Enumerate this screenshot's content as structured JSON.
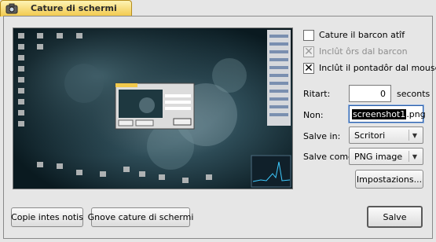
{
  "tab": {
    "title": "Cature di schermi"
  },
  "options": {
    "capture_window": {
      "label": "Cature il barcon atîf",
      "checked": false,
      "enabled": true
    },
    "include_borders": {
      "label": "Inclût ôrs dal barcon",
      "checked": true,
      "enabled": false
    },
    "include_pointer": {
      "label": "Inclût il pontadôr dal mouse",
      "checked": true,
      "enabled": true
    }
  },
  "delay": {
    "label": "Ritart:",
    "value": "0",
    "unit": "seconts"
  },
  "name": {
    "label": "Non:",
    "value": "screenshot1.png",
    "selected_part": "screenshot1",
    "rest": ".png"
  },
  "save_in": {
    "label": "Salve in:",
    "value": "Scritori"
  },
  "save_as": {
    "label": "Salve come:",
    "value": "PNG image"
  },
  "buttons": {
    "settings": "Impostazions...",
    "copy": "Copie intes notis",
    "new_capture": "Gnove cature di schermi",
    "save": "Salve"
  },
  "icons": {
    "tab": "camera-icon",
    "checkmark": "checkmark-icon",
    "dropdown": "chevron-down-icon"
  }
}
